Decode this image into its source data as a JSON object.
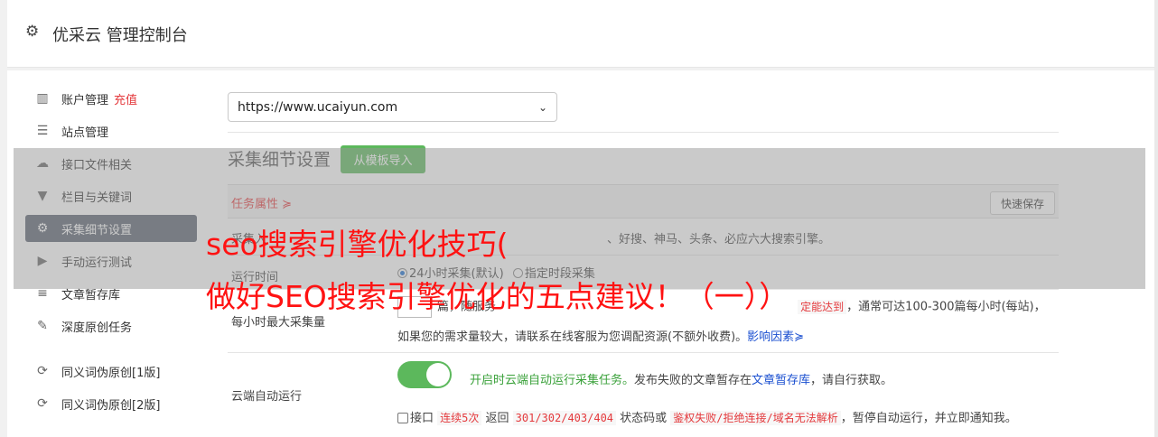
{
  "header": {
    "title": "优采云 管理控制台",
    "icon": "gear-icon"
  },
  "sidebar": {
    "items": [
      {
        "label": "账户管理",
        "extra": "充值",
        "icon": "bar-chart-icon"
      },
      {
        "label": "站点管理",
        "icon": "server-icon"
      },
      {
        "label": "接口文件相关",
        "icon": "cloud-upload-icon"
      },
      {
        "label": "栏目与关键词",
        "icon": "filter-icon"
      },
      {
        "label": "采集细节设置",
        "icon": "gears-icon",
        "active": true
      },
      {
        "label": "手动运行测试",
        "icon": "play-circle-icon"
      },
      {
        "label": "文章暂存库",
        "icon": "database-icon"
      },
      {
        "label": "深度原创任务",
        "icon": "edit-icon"
      },
      {
        "label": "同义词伪原创[1版]",
        "icon": "refresh-icon"
      },
      {
        "label": "同义词伪原创[2版]",
        "icon": "refresh-icon"
      }
    ]
  },
  "main": {
    "site_select": "https://www.ucaiyun.com",
    "section_title": "采集细节设置",
    "template_button": "从模板导入",
    "props_label": "任务属性 ≽",
    "quick_save": "快速保存",
    "rows": {
      "engines": {
        "key": "采集入",
        "value": "、好搜、神马、头条、必应六大搜索引擎。"
      },
      "runtime": {
        "key": "运行时间",
        "opt1": "24小时采集(默认)",
        "opt2": "指定时段采集"
      },
      "max_per_hour": {
        "key": "每小时最大采集量",
        "v1": "篇，随服务",
        "v2": "定能达到",
        "v3": "，通常可达100-300篇每小时(每站)，",
        "v4": "如果您的需求量较大，请联系在线客服为您调配资源(不额外收费)。",
        "link": "影响因素≽"
      },
      "cloud": {
        "key": "云端自动运行",
        "on_text": "开启时云端自动运行采集任务。",
        "desc": "发布失败的文章暂存在",
        "link": "文章暂存库",
        "desc2": "，请自行获取。",
        "cb_label": "接口",
        "c1": "连续5次",
        "c2": " 返回 ",
        "c3": "301/302/403/404",
        "c4": " 状态码或 ",
        "c5": "鉴权失败/拒绝连接/域名无法解析",
        "c6": "，暂停自动运行，并立即通知我。"
      }
    }
  },
  "watermark": {
    "line1": "seo搜索引擎优化技巧(",
    "line2": "做好SEO搜索引擎优化的五点建议！（一））"
  }
}
